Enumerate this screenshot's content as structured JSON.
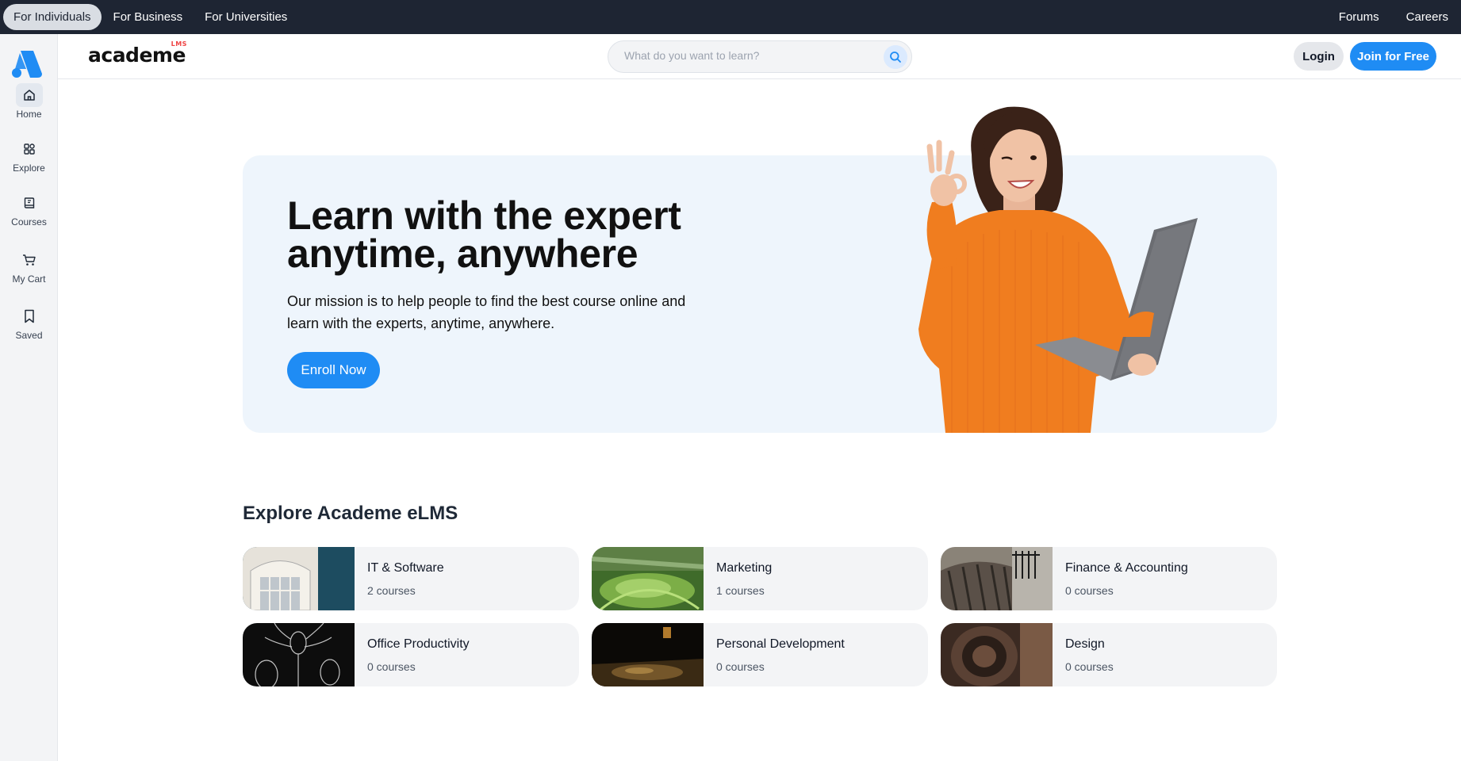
{
  "topbar": {
    "segments": [
      "For Individuals",
      "For Business",
      "For Universities"
    ],
    "links": [
      "Forums",
      "Careers"
    ]
  },
  "sidebar": {
    "items": [
      {
        "label": "Home",
        "icon": "home-icon"
      },
      {
        "label": "Explore",
        "icon": "grid-icon"
      },
      {
        "label": "Courses",
        "icon": "book-icon"
      },
      {
        "label": "My Cart",
        "icon": "cart-icon"
      },
      {
        "label": "Saved",
        "icon": "bookmark-icon"
      }
    ]
  },
  "header": {
    "brand": "academe",
    "brand_sup": "LMS",
    "search_placeholder": "What do you want to learn?",
    "login": "Login",
    "join": "Join for Free"
  },
  "hero": {
    "title": "Learn with the expert anytime, anywhere",
    "subtitle": "Our mission is to help people to find the best course online and learn with the experts, anytime, anywhere.",
    "cta": "Enroll Now"
  },
  "explore": {
    "title": "Explore Academe eLMS",
    "categories": [
      {
        "name": "IT & Software",
        "count": "2 courses"
      },
      {
        "name": "Marketing",
        "count": "1 courses"
      },
      {
        "name": "Finance & Accounting",
        "count": "0 courses"
      },
      {
        "name": "Office Productivity",
        "count": "0 courses"
      },
      {
        "name": "Personal Development",
        "count": "0 courses"
      },
      {
        "name": "Design",
        "count": "0 courses"
      }
    ]
  },
  "colors": {
    "accent": "#1f8cf4",
    "topbar": "#1e2533",
    "hero_bg": "#eef5fc",
    "card_bg": "#f3f4f6"
  }
}
